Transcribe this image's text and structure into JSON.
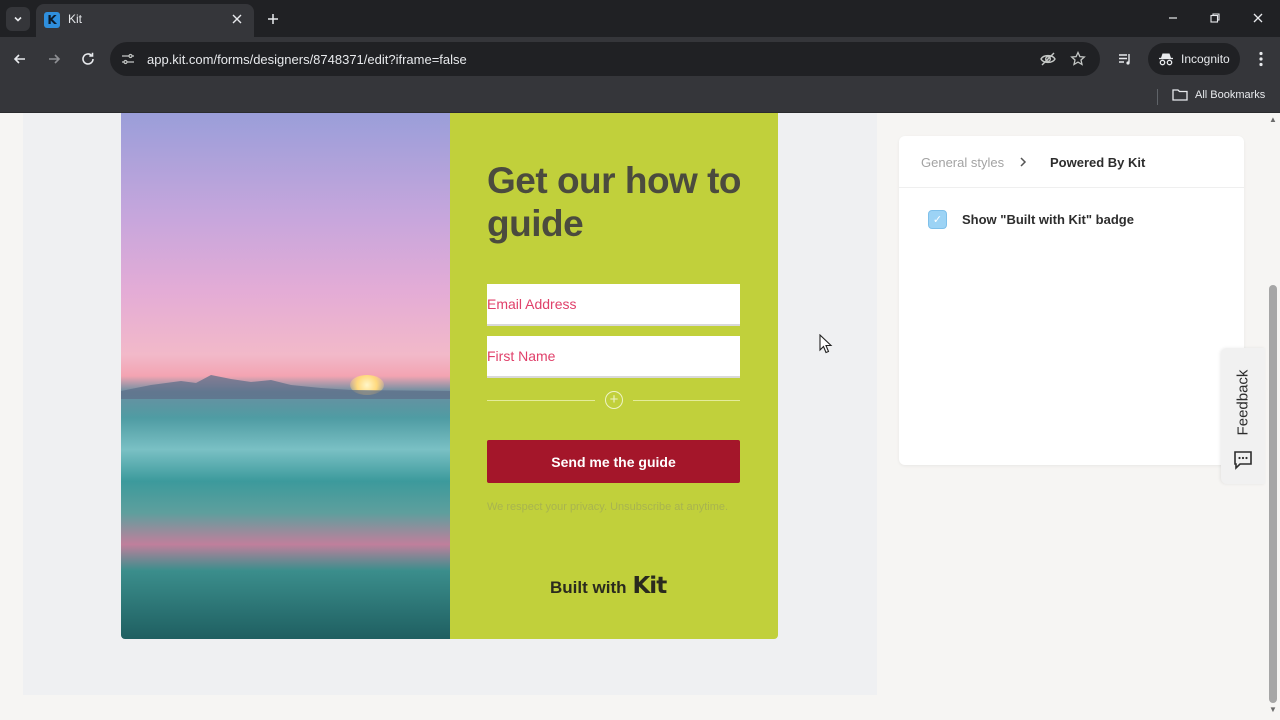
{
  "browser": {
    "tab_title": "Kit",
    "tab_favicon_letter": "K",
    "url": "app.kit.com/forms/designers/8748371/edit?iframe=false",
    "incognito_label": "Incognito",
    "bookmarks_label": "All Bookmarks"
  },
  "form": {
    "headline": "Get our how to guide",
    "email_placeholder": "Email Address",
    "first_name_placeholder": "First Name",
    "submit_label": "Send me the guide",
    "privacy_text": "We respect your privacy. Unsubscribe at anytime.",
    "built_with_text": "Built with",
    "built_with_brand": "Kit",
    "colors": {
      "content_bg": "#c1d03b",
      "button_bg": "#a4162a",
      "headline": "#4b4b3e",
      "placeholder": "#e0406a"
    }
  },
  "panel": {
    "breadcrumb_parent": "General styles",
    "breadcrumb_current": "Powered By Kit",
    "checkbox_label": "Show \"Built with Kit\" badge",
    "checkbox_checked": true
  },
  "feedback": {
    "label": "Feedback"
  },
  "icons": {
    "tab_menu": "chevron-down-icon",
    "tab_close": "close-icon",
    "new_tab": "plus-icon",
    "back": "arrow-left-icon",
    "forward": "arrow-right-icon",
    "reload": "reload-icon",
    "site_info": "tune-icon",
    "eye_off": "eye-off-icon",
    "star": "star-icon",
    "reading_list": "media-icon",
    "incognito": "incognito-icon",
    "more": "more-vertical-icon",
    "folder": "folder-icon",
    "chat": "chat-icon"
  }
}
